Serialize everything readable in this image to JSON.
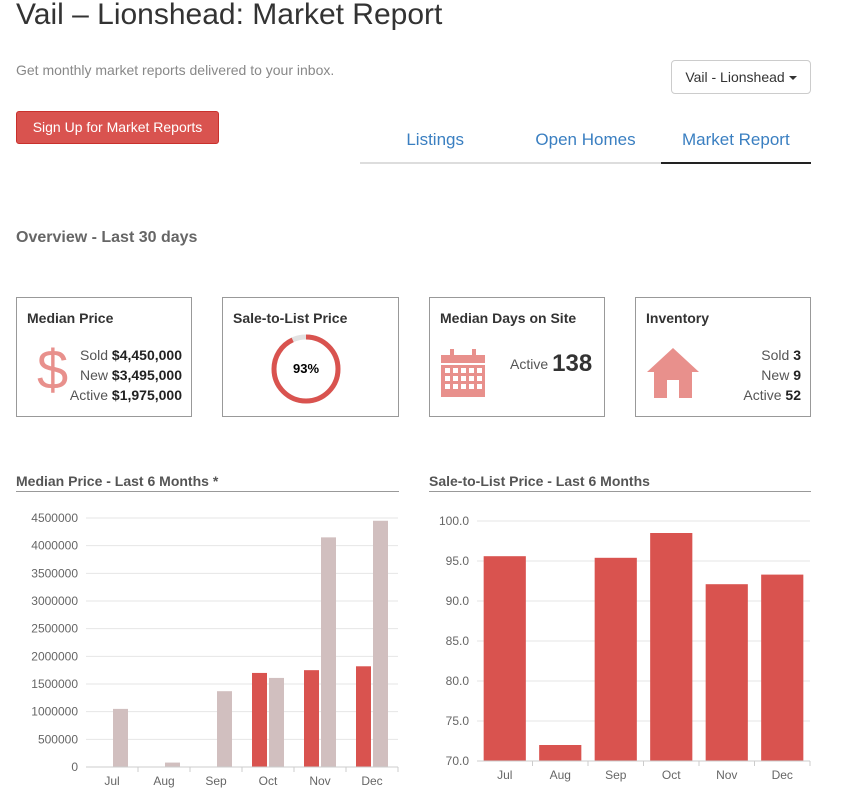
{
  "page": {
    "title": "Vail – Lionshead: Market Report"
  },
  "promo": {
    "text": "Get monthly market reports delivered to your inbox.",
    "signup_label": "Sign Up for Market Reports"
  },
  "area_select": {
    "value": "Vail - Lionshead"
  },
  "tabs": [
    {
      "label": "Listings",
      "active": false
    },
    {
      "label": "Open Homes",
      "active": false
    },
    {
      "label": "Market Report",
      "active": true
    }
  ],
  "overview": {
    "title": "Overview - Last 30 days",
    "median_price": {
      "title": "Median Price",
      "icon": "dollar-icon",
      "sold_label": "Sold",
      "sold_value": "$4,450,000",
      "new_label": "New",
      "new_value": "$3,495,000",
      "active_label": "Active",
      "active_value": "$1,975,000"
    },
    "sale_to_list": {
      "title": "Sale-to-List Price",
      "value_label": "93%",
      "percent": 93
    },
    "median_days": {
      "title": "Median Days on Site",
      "icon": "calendar-icon",
      "label": "Active",
      "value": "138"
    },
    "inventory": {
      "title": "Inventory",
      "icon": "house-icon",
      "sold_label": "Sold",
      "sold_value": "3",
      "new_label": "New",
      "new_value": "9",
      "active_label": "Active",
      "active_value": "52"
    }
  },
  "colors": {
    "accent": "#d9534f",
    "muted_bar": "#d1bfbf",
    "icon": "#e8908c",
    "link": "#3a7fc1"
  },
  "chart_data": [
    {
      "type": "bar",
      "title": "Median Price - Last 6 Months *",
      "categories": [
        "Jul",
        "Aug",
        "Sep",
        "Oct",
        "Nov",
        "Dec"
      ],
      "ylim": [
        0,
        4500000
      ],
      "yticks": [
        0,
        500000,
        1000000,
        1500000,
        2000000,
        2500000,
        3000000,
        3500000,
        4000000,
        4500000
      ],
      "ytick_labels": [
        "0",
        "500000",
        "1000000",
        "1500000",
        "2000000",
        "2500000",
        "3000000",
        "3500000",
        "4000000",
        "4500000"
      ],
      "grid": true,
      "series": [
        {
          "color": "#d9534f",
          "values": [
            0,
            0,
            0,
            1700000,
            1750000,
            1820000
          ]
        },
        {
          "color": "#d1bfbf",
          "values": [
            1050000,
            80000,
            1370000,
            1610000,
            4150000,
            4450000
          ]
        }
      ]
    },
    {
      "type": "bar",
      "title": "Sale-to-List Price - Last 6 Months",
      "categories": [
        "Jul",
        "Aug",
        "Sep",
        "Oct",
        "Nov",
        "Dec"
      ],
      "ylim": [
        70,
        100
      ],
      "yticks": [
        70,
        75,
        80,
        85,
        90,
        95,
        100
      ],
      "ytick_labels": [
        "70.0",
        "75.0",
        "80.0",
        "85.0",
        "90.0",
        "95.0",
        "100.0"
      ],
      "grid": true,
      "series": [
        {
          "color": "#d9534f",
          "values": [
            95.6,
            72.0,
            95.4,
            98.5,
            92.1,
            93.3
          ]
        }
      ]
    }
  ]
}
